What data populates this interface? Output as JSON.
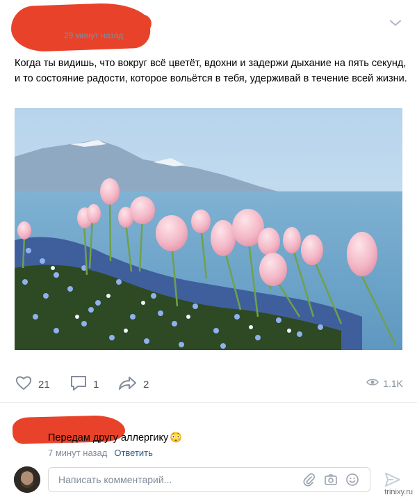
{
  "post": {
    "time": "29 минут назад",
    "text": "Когда ты видишь, что вокруг всё цветёт, вдохни и задержи дыхание на пять секунд, и то состояние радости, которое вольётся в тебя, удерживай в течение всей жизни.",
    "photo_icon": "photo-tulips-lake-mountains"
  },
  "actions": {
    "likes": "21",
    "comments": "1",
    "shares": "2",
    "views": "1.1K"
  },
  "comment": {
    "text": "Передам другу аллергику",
    "emoji": "😳",
    "time": "7 минут назад",
    "reply_label": "Ответить"
  },
  "composer": {
    "placeholder": "Написать комментарий..."
  },
  "watermark": "trinixy.ru",
  "colors": {
    "redaction": "#e8432a",
    "link": "#2a5885",
    "muted": "#818c99"
  }
}
